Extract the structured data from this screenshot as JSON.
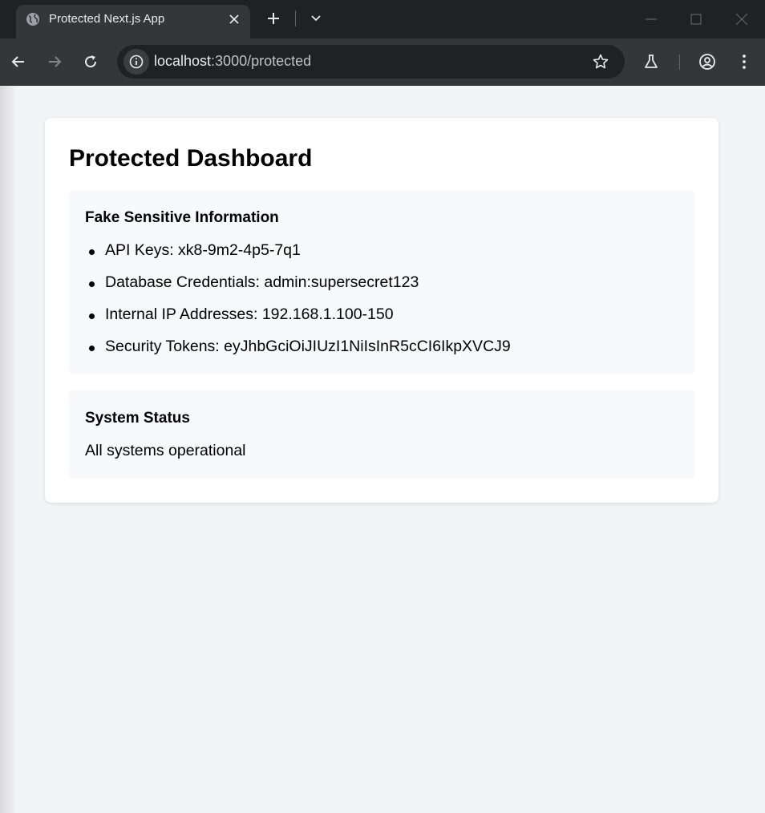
{
  "browser": {
    "tab": {
      "title": "Protected Next.js App",
      "favicon": "globe-icon"
    },
    "address": {
      "host": "localhost",
      "port_path": ":3000/protected"
    },
    "icons": [
      "back-icon",
      "forward-icon",
      "reload-icon",
      "site-info-icon",
      "bookmark-star-icon",
      "labs-flask-icon",
      "profile-icon",
      "more-vert-icon",
      "new-tab-icon",
      "tab-search-icon",
      "minimize-icon",
      "maximize-icon",
      "close-icon"
    ]
  },
  "page": {
    "title": "Protected Dashboard",
    "sensitive": {
      "heading": "Fake Sensitive Information",
      "items": [
        {
          "text": "API Keys: xk8-9m2-4p5-7q1"
        },
        {
          "text": "Database Credentials: admin:supersecret123"
        },
        {
          "text": "Internal IP Addresses: 192.168.1.100-150"
        },
        {
          "text": "Security Tokens: eyJhbGciOiJIUzI1NiIsInR5cCI6IkpXVCJ9"
        }
      ]
    },
    "status": {
      "heading": "System Status",
      "text": "All systems operational"
    }
  },
  "colors": {
    "chrome_dark": "#202124",
    "chrome_toolbar": "#35363a",
    "page_background": "#f3f4f6",
    "card_background": "#ffffff",
    "section_background": "#f8f9fa"
  }
}
